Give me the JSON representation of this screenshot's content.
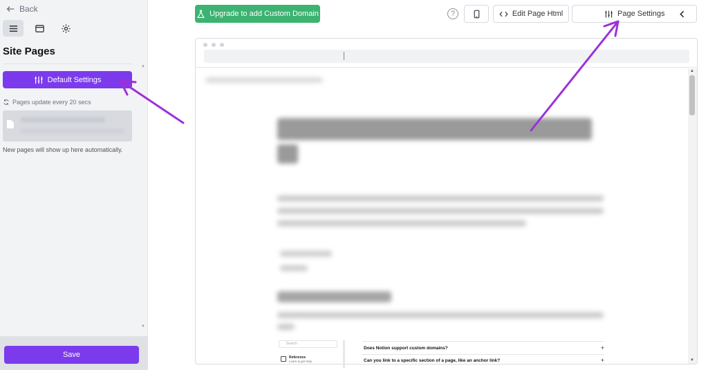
{
  "sidebar": {
    "back_label": "Back",
    "section_title": "Site Pages",
    "default_settings_label": "Default Settings",
    "update_note": "Pages update every 20 secs",
    "new_pages_note": "New pages will show up here automatically.",
    "save_label": "Save"
  },
  "toolbar": {
    "upgrade_label": "Upgrade to add Custom Domain",
    "help_glyph": "?",
    "edit_html_label": "Edit Page Html",
    "page_settings_label": "Page Settings"
  },
  "preview": {
    "faq_questions": [
      "Does Notion support custom domains?",
      "Can you link to a specific section of a page, like an anchor link?"
    ],
    "faq_plus": "+",
    "mini_search_placeholder": "Search",
    "mini_reference_title": "Reference",
    "mini_reference_sub": "Learn & get help"
  },
  "colors": {
    "accent_purple": "#7c3aed",
    "upgrade_green": "#3cb371",
    "annotation_arrow": "#9b30d9"
  },
  "icons": [
    "arrow-left-icon",
    "menu-icon",
    "browser-window-icon",
    "gear-icon",
    "sliders-icon",
    "refresh-icon",
    "document-icon",
    "flask-icon",
    "help-icon",
    "mobile-phone-icon",
    "code-icon",
    "chevron-left-icon"
  ]
}
